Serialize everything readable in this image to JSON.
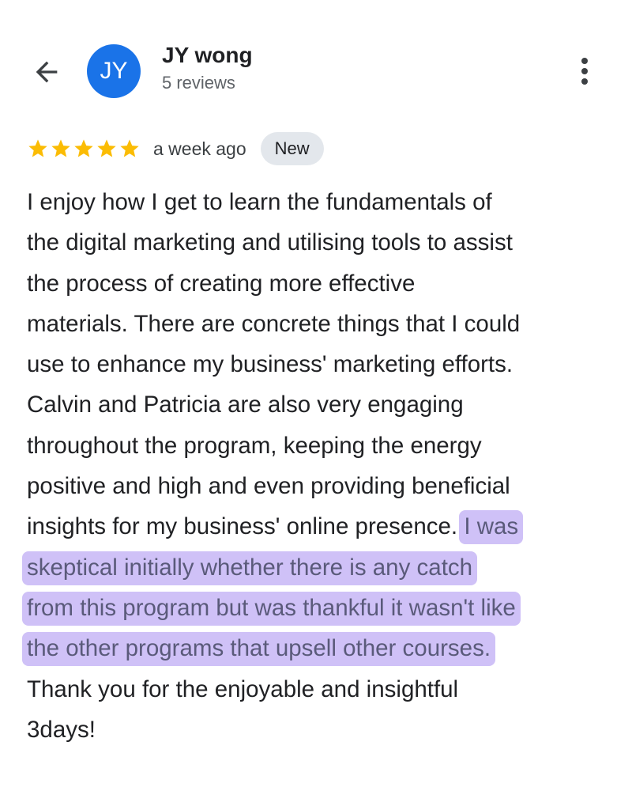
{
  "header": {
    "back_icon": "arrow-left-icon",
    "avatar_initials": "JY",
    "avatar_color": "#1a73e8",
    "reviewer_name": "JY wong",
    "review_count": "5 reviews",
    "more_icon": "more-vertical-icon"
  },
  "review": {
    "rating": 5,
    "max_rating": 5,
    "star_color": "#fbbc04",
    "time": "a week ago",
    "badge": "New",
    "lines": [
      {
        "plain": "I enjoy how I get to learn the fundamentals of",
        "highlight": ""
      },
      {
        "plain": "the digital marketing and utilising tools to assist",
        "highlight": ""
      },
      {
        "plain": "the process of creating more effective",
        "highlight": ""
      },
      {
        "plain": "materials. There are concrete things that I could",
        "highlight": ""
      },
      {
        "plain": "use to enhance my business' marketing efforts.",
        "highlight": ""
      },
      {
        "plain": "Calvin and Patricia are also very engaging",
        "highlight": ""
      },
      {
        "plain": "throughout the program, keeping the energy",
        "highlight": ""
      },
      {
        "plain": "positive and high and even providing beneficial",
        "highlight": ""
      },
      {
        "plain": "insights for my business' online presence. ",
        "highlight": "I was"
      },
      {
        "plain": "",
        "highlight": "skeptical initially whether there is any catch"
      },
      {
        "plain": "",
        "highlight": "from this program but was thankful it wasn't like"
      },
      {
        "plain": "",
        "highlight": "the other programs that upsell other courses."
      },
      {
        "plain": "Thank you for the enjoyable and insightful",
        "highlight": ""
      },
      {
        "plain": "3days!",
        "highlight": ""
      }
    ],
    "highlight_color": "#cfc1f7"
  }
}
